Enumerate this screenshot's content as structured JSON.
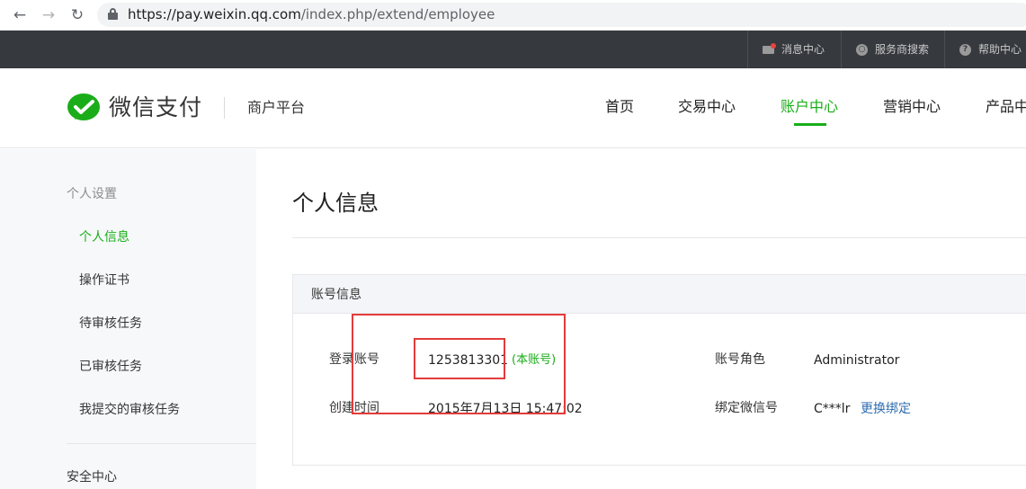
{
  "browser": {
    "url_host": "https://pay.weixin.qq.com",
    "url_path": "/index.php/extend/employee"
  },
  "topbar": {
    "items": [
      {
        "label": "消息中心",
        "icon": "mail-icon"
      },
      {
        "label": "服务商搜索",
        "icon": "search-icon"
      },
      {
        "label": "帮助中心",
        "icon": "help-icon"
      }
    ]
  },
  "header": {
    "brand": "微信支付",
    "platform": "商户平台",
    "nav": [
      "首页",
      "交易中心",
      "账户中心",
      "营销中心",
      "产品中心"
    ],
    "active_nav": "账户中心"
  },
  "sidebar": {
    "group1": "个人设置",
    "items": [
      "个人信息",
      "操作证书",
      "待审核任务",
      "已审核任务",
      "我提交的审核任务"
    ],
    "active": "个人信息",
    "group2": "安全中心"
  },
  "main": {
    "title": "个人信息",
    "panel_title": "账号信息",
    "login_account_label": "登录账号",
    "login_account_value": "1253813301",
    "this_account_tag": "(本账号)",
    "role_label": "账号角色",
    "role_value": "Administrator",
    "created_label": "创建时间",
    "created_value": "2015年7月13日 15:47:02",
    "wechat_label": "绑定微信号",
    "wechat_value": "C***lr",
    "rebind_link": "更换绑定"
  },
  "colors": {
    "accent_green": "#1aad19",
    "topbar_bg": "#36393e",
    "highlight_red": "#e33b3b",
    "link_blue": "#2e6db0"
  }
}
